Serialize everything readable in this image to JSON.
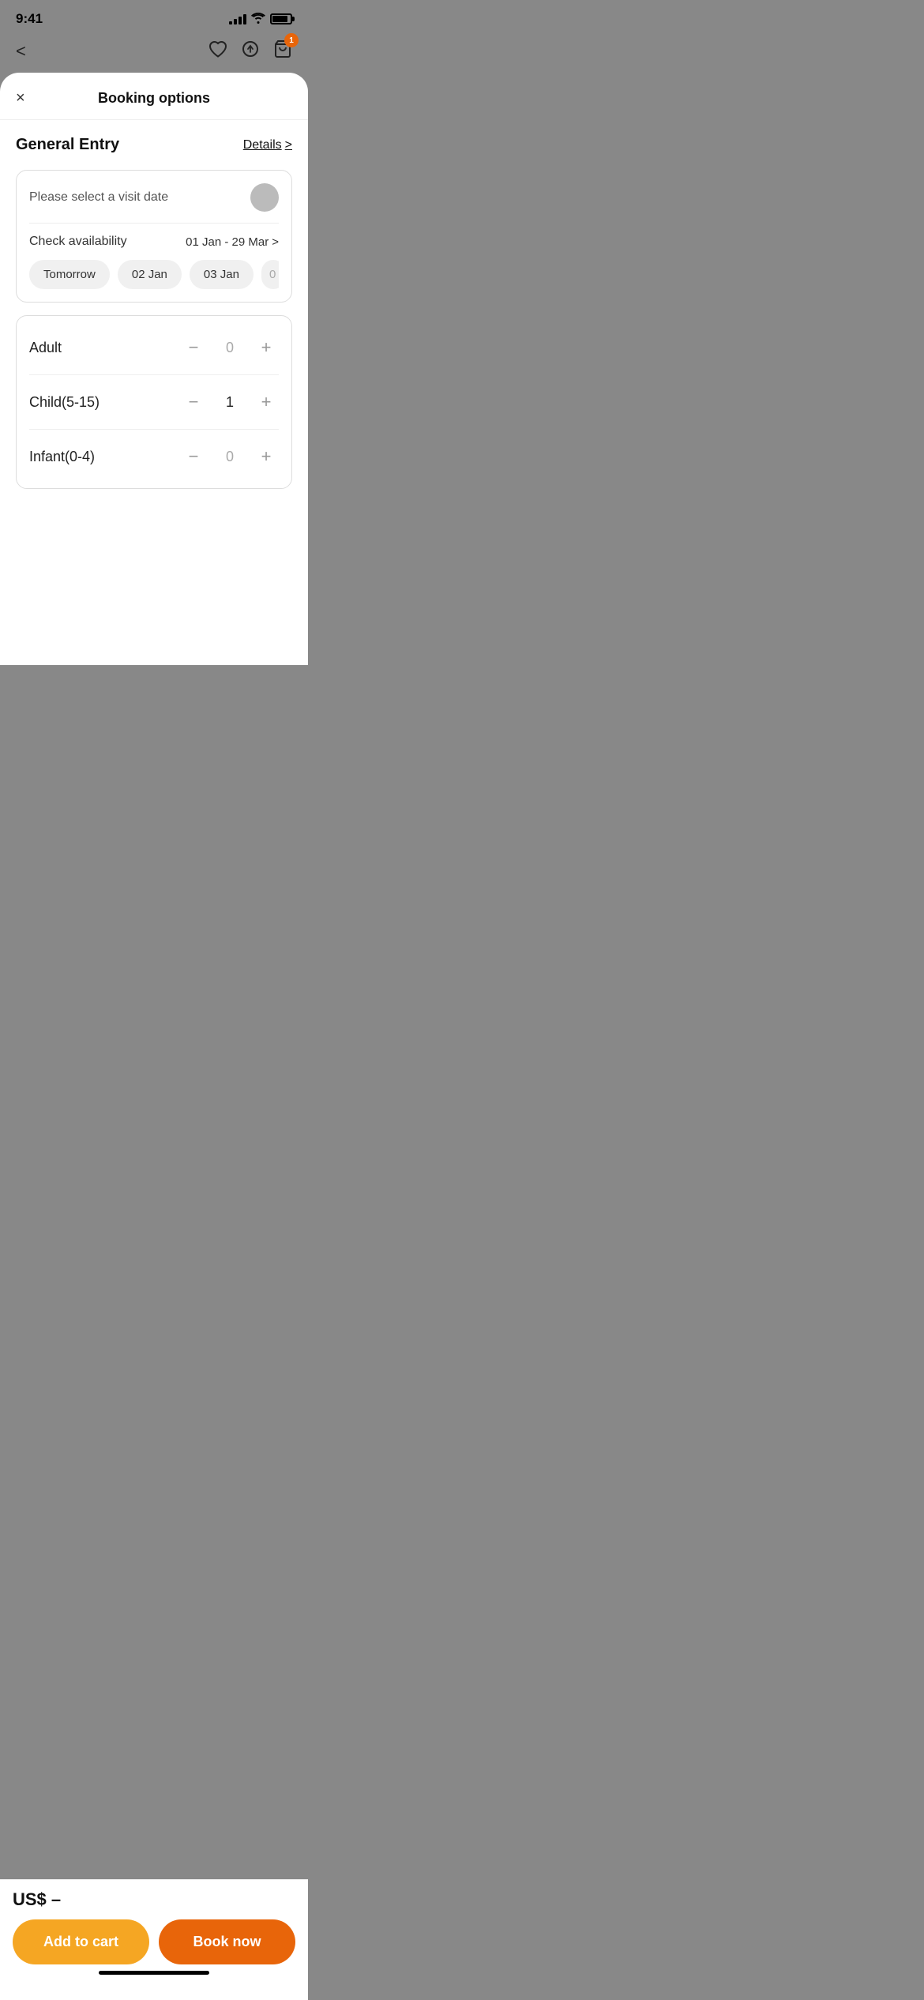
{
  "statusBar": {
    "time": "9:41",
    "cartBadge": "1"
  },
  "header": {
    "title": "Booking options",
    "closeLabel": "×",
    "backLabel": "<"
  },
  "entrySection": {
    "title": "General Entry",
    "detailsLabel": "Details",
    "detailsChevron": ">"
  },
  "dateSection": {
    "selectLabel": "Please select a visit date",
    "availabilityLabel": "Check availability",
    "availabilityRange": "01 Jan - 29 Mar",
    "availabilityChevron": ">",
    "chips": [
      "Tomorrow",
      "02 Jan",
      "03 Jan",
      "0"
    ]
  },
  "quantities": [
    {
      "label": "Adult",
      "value": "0",
      "active": false
    },
    {
      "label": "Child(5-15)",
      "value": "1",
      "active": true
    },
    {
      "label": "Infant(0-4)",
      "value": "0",
      "active": false
    }
  ],
  "footer": {
    "priceLabel": "US$ –",
    "addToCartLabel": "Add to cart",
    "bookNowLabel": "Book now"
  }
}
